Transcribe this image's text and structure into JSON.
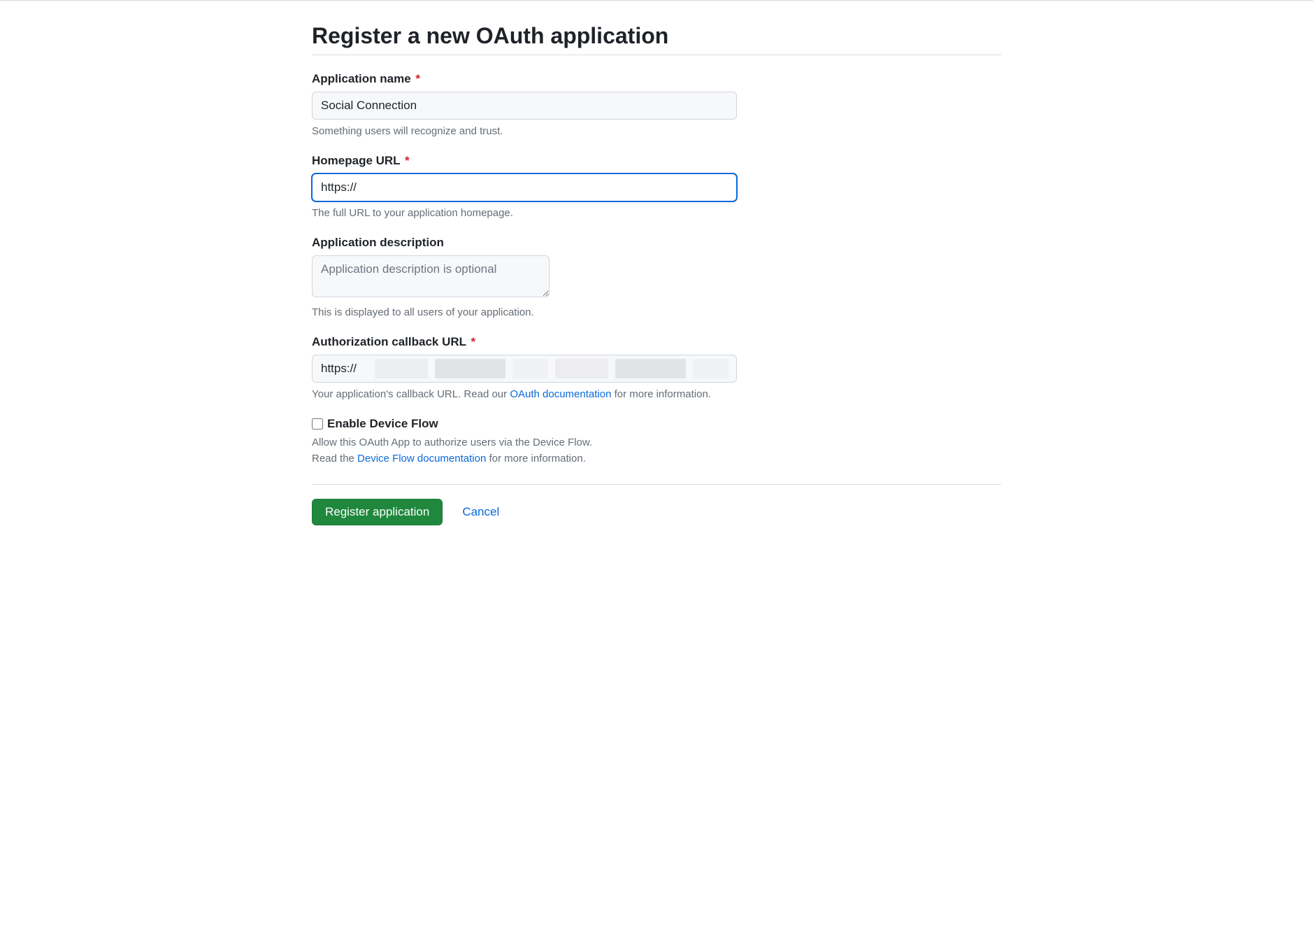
{
  "page": {
    "title": "Register a new OAuth application"
  },
  "fields": {
    "appName": {
      "label": "Application name",
      "required": true,
      "value": "Social Connection",
      "help": "Something users will recognize and trust."
    },
    "homepageUrl": {
      "label": "Homepage URL",
      "required": true,
      "value": "https://",
      "help": "The full URL to your application homepage."
    },
    "description": {
      "label": "Application description",
      "required": false,
      "placeholder": "Application description is optional",
      "value": "",
      "help": "This is displayed to all users of your application."
    },
    "callbackUrl": {
      "label": "Authorization callback URL",
      "required": true,
      "value": "https://",
      "helpPrefix": "Your application's callback URL. Read our ",
      "helpLinkText": "OAuth documentation",
      "helpSuffix": " for more information."
    },
    "deviceFlow": {
      "label": "Enable Device Flow",
      "checked": false,
      "help1": "Allow this OAuth App to authorize users via the Device Flow.",
      "help2Prefix": "Read the ",
      "help2LinkText": "Device Flow documentation",
      "help2Suffix": " for more information."
    }
  },
  "actions": {
    "submit": "Register application",
    "cancel": "Cancel"
  },
  "requiredMark": "*"
}
